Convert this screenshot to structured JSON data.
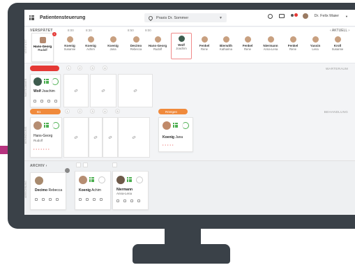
{
  "app": {
    "title": "Patientensteuerung",
    "praxis": "Praxis Dr. Sommer",
    "user": "Dr. Felix Maier"
  },
  "late": {
    "label": "VERSPÄTET",
    "times": [
      "8:00",
      "8:30",
      "8:50",
      "9:00"
    ],
    "aktuell": "AKTUELL",
    "first": {
      "first": "Hans-Georg",
      "last": "Rudolf",
      "badge": "1"
    },
    "patients": [
      {
        "last": "Koenig",
        "first": "Susanne"
      },
      {
        "last": "Koenig",
        "first": "Achim"
      },
      {
        "last": "Koenig",
        "first": "Jana"
      },
      {
        "last": "Decimo",
        "first": "Rebecca"
      },
      {
        "last": "Hans-Georg",
        "first": "Rudolf"
      },
      {
        "last": "Wolf",
        "first": "Joachim"
      },
      {
        "last": "Fenkel",
        "first": "Rene"
      },
      {
        "last": "Bierwith",
        "first": "Katharina"
      },
      {
        "last": "Fenkel",
        "first": "Rene"
      },
      {
        "last": "Niermann",
        "first": "Anna-Lena"
      },
      {
        "last": "Fenkel",
        "first": "Rene"
      },
      {
        "last": "Yassin",
        "first": "Lena"
      },
      {
        "last": "Kroll",
        "first": "Susanne"
      }
    ]
  },
  "wait": {
    "zone": "WARTERAUM",
    "side": "WARTEZIMMER",
    "slots": [
      "1",
      "2",
      "3",
      "4"
    ],
    "patient": {
      "last": "Wolf",
      "first": "Joachim"
    }
  },
  "treat": {
    "zone": "BEHANDLUNG",
    "side": "BEHANDLUNG",
    "room1": "B1",
    "room2": "Röntgen",
    "slots": [
      "1",
      "2",
      "3",
      "4",
      "5"
    ],
    "patient1": {
      "first": "Hans-Georg",
      "last": "Rudolf"
    },
    "patient2": {
      "last": "Koenig",
      "first": "Jana"
    }
  },
  "archive": {
    "label": "ARCHIV",
    "side": "ABRECHNUNG",
    "p1": {
      "last": "Decimo",
      "first": "Rebecca"
    },
    "p2": {
      "last": "Koenig",
      "first": "Achim"
    },
    "p3": {
      "last": "Niermann",
      "first": "Anna-Lena"
    }
  },
  "colors": {
    "accent": "#b6337f",
    "late": "#e53935",
    "room": "#f08a3c",
    "green": "#4caf50"
  }
}
